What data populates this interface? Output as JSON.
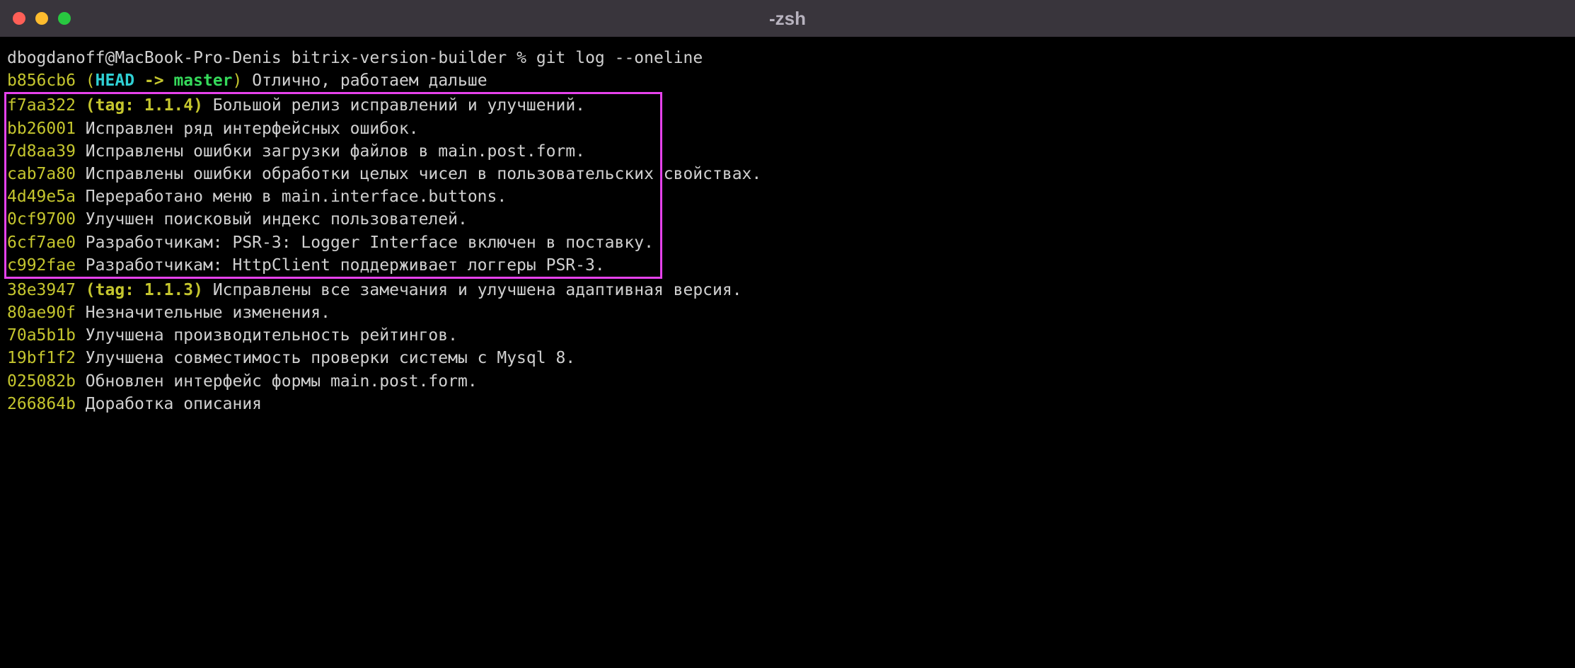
{
  "window": {
    "title": "-zsh"
  },
  "prompt": {
    "user": "dbogdanoff",
    "host": "MacBook-Pro-Denis",
    "cwd": "bitrix-version-builder",
    "symbol": "%",
    "command": "git log --oneline"
  },
  "head_line": {
    "hash": "b856cb6",
    "open": "(",
    "head": "HEAD",
    "arrow": " -> ",
    "branch": "master",
    "close": ")",
    "msg": " Отлично, работаем дальше"
  },
  "box_lines": [
    {
      "hash": "f7aa322",
      "tag": "(tag: 1.1.4)",
      "msg": " Большой релиз исправлений и улучшений."
    },
    {
      "hash": "bb26001",
      "tag": "",
      "msg": " Исправлен ряд интерфейсных ошибок."
    },
    {
      "hash": "7d8aa39",
      "tag": "",
      "msg": " Исправлены ошибки загрузки файлов в main.post.form."
    },
    {
      "hash": "cab7a80",
      "tag": "",
      "msg": " Исправлены ошибки обработки целых чисел в пользовательских свойствах."
    },
    {
      "hash": "4d49e5a",
      "tag": "",
      "msg": " Переработано меню в main.interface.buttons."
    },
    {
      "hash": "0cf9700",
      "tag": "",
      "msg": " Улучшен поисковый индекс пользователей."
    },
    {
      "hash": "6cf7ae0",
      "tag": "",
      "msg": " Разработчикам: PSR-3: Logger Interface включен в поставку."
    },
    {
      "hash": "c992fae",
      "tag": "",
      "msg": " Разработчикам: HttpClient поддерживает логгеры PSR-3."
    }
  ],
  "tail_lines": [
    {
      "hash": "38e3947",
      "tag": "(tag: 1.1.3)",
      "msg": " Исправлены все замечания и улучшена адаптивная версия."
    },
    {
      "hash": "80ae90f",
      "tag": "",
      "msg": " Незначительные изменения."
    },
    {
      "hash": "70a5b1b",
      "tag": "",
      "msg": " Улучшена производительность рейтингов."
    },
    {
      "hash": "19bf1f2",
      "tag": "",
      "msg": " Улучшена совместимость проверки системы с Mysql 8."
    },
    {
      "hash": "025082b",
      "tag": "",
      "msg": " Обновлен интерфейс формы main.post.form."
    },
    {
      "hash": "266864b",
      "tag": "",
      "msg": " Доработка описания"
    }
  ]
}
